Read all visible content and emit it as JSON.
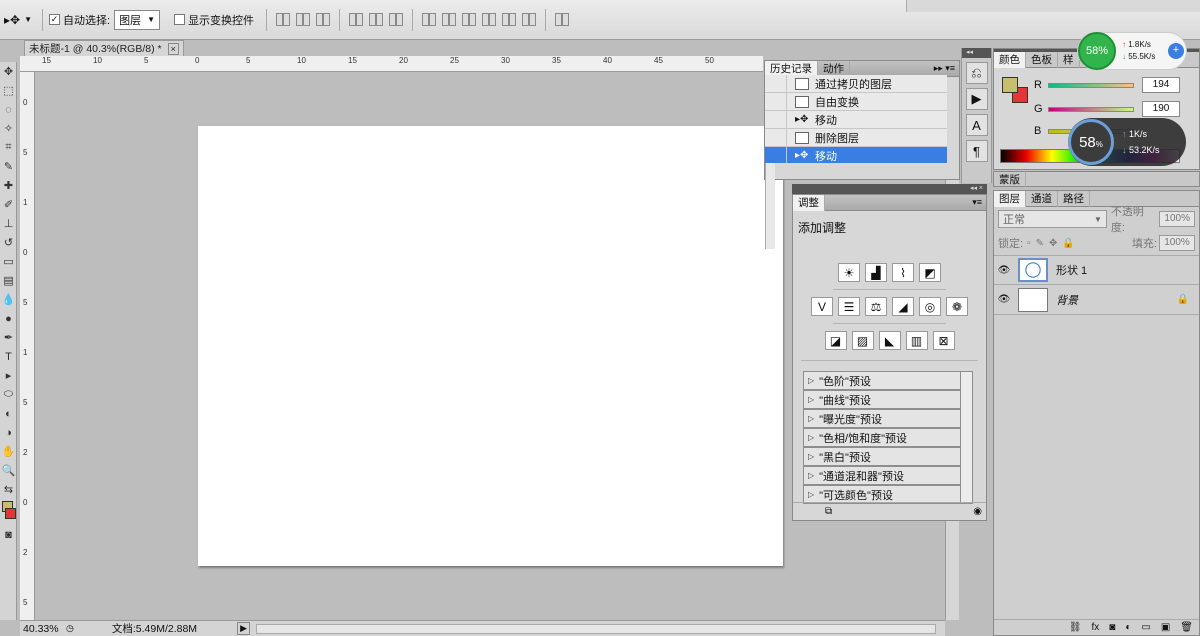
{
  "option_bar": {
    "auto_select_label": "自动选择:",
    "auto_select_checked": true,
    "auto_select_value": "图层",
    "show_transform_label": "显示变换控件",
    "show_transform_checked": false
  },
  "document": {
    "tab_title": "未标题-1 @ 40.3%(RGB/8) *",
    "zoom": "40.33%",
    "doc_size": "文档:5.49M/2.88M",
    "ruler_top": [
      "15",
      "10",
      "5",
      "0",
      "5",
      "10",
      "15",
      "20",
      "25",
      "30",
      "35",
      "40",
      "45",
      "50"
    ],
    "ruler_left": [
      "0",
      "5",
      "1",
      "0",
      "5",
      "1",
      "5",
      "2",
      "0",
      "2",
      "5"
    ],
    "crescent_color": "#0a56b4"
  },
  "history_panel": {
    "tabs": [
      "历史记录",
      "动作"
    ],
    "items": [
      {
        "label": "通过拷贝的图层",
        "icon": "doc-icon",
        "active": false
      },
      {
        "label": "自由变换",
        "icon": "doc-icon",
        "active": false
      },
      {
        "label": "移动",
        "icon": "move-icon",
        "active": false
      },
      {
        "label": "删除图层",
        "icon": "doc-icon",
        "active": false
      },
      {
        "label": "移动",
        "icon": "move-icon",
        "active": true
      }
    ]
  },
  "adjustments_panel": {
    "tab": "调整",
    "title": "添加调整",
    "presets": [
      "\"色阶\"预设",
      "\"曲线\"预设",
      "\"曝光度\"预设",
      "\"色相/饱和度\"预设",
      "\"黑白\"预设",
      "\"通道混和器\"预设",
      "\"可选颜色\"预设"
    ]
  },
  "color_panel": {
    "tabs": [
      "颜色",
      "色板",
      "样"
    ],
    "channels": [
      {
        "name": "R",
        "value": "194"
      },
      {
        "name": "G",
        "value": "190"
      },
      {
        "name": "B",
        "value": ""
      }
    ],
    "fg_color": "#c8bf6e",
    "bg_color": "#e53535"
  },
  "network_widget": {
    "percent_small": "58%",
    "up_small": "1.8K/s",
    "down_small": "55.5K/s",
    "percent_large": "58",
    "percent_large_unit": "%",
    "up_large": "1K/s",
    "down_large": "53.2K/s"
  },
  "masks_panel": {
    "tab": "蒙版"
  },
  "layers_panel": {
    "tabs": [
      "图层",
      "通道",
      "路径"
    ],
    "blend_mode": "正常",
    "opacity_label": "不透明度:",
    "opacity_value": "100%",
    "lock_label": "锁定:",
    "fill_label": "填充:",
    "fill_value": "100%",
    "layers": [
      {
        "name": "形状 1"
      },
      {
        "name": "背景"
      }
    ]
  }
}
